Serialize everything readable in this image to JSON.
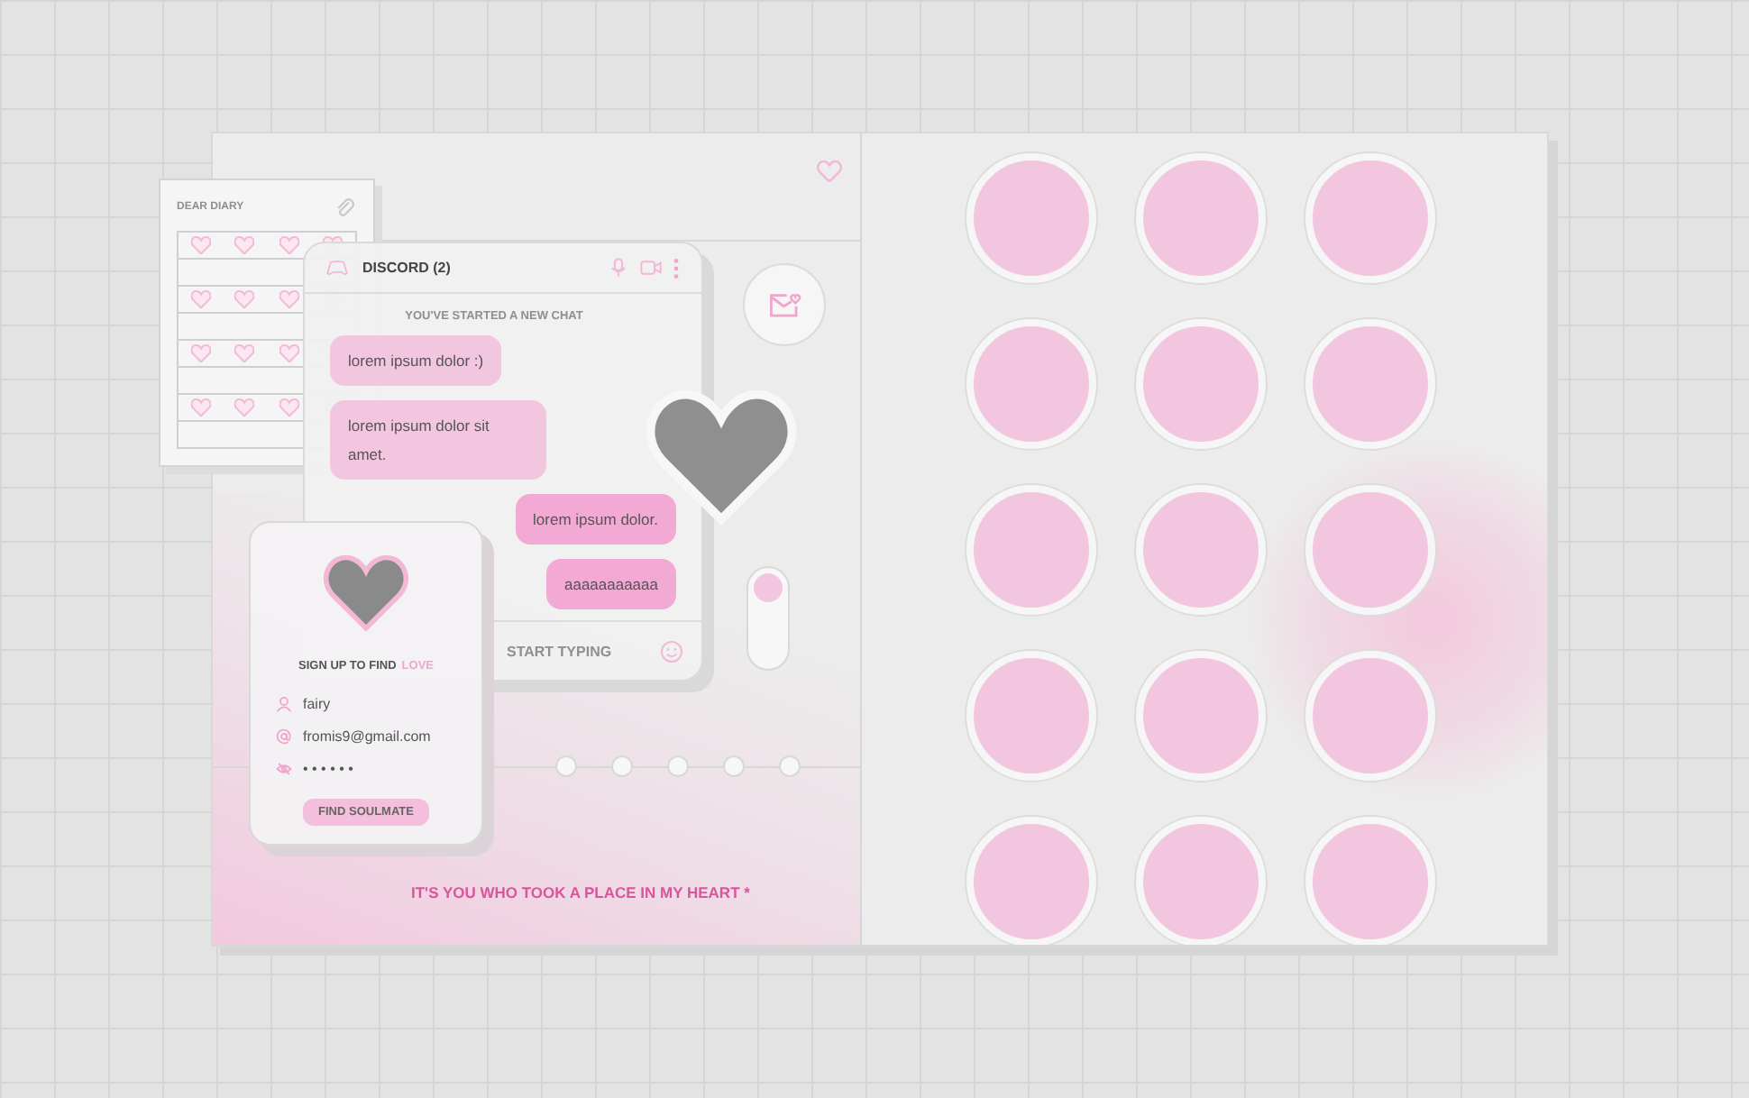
{
  "diary": {
    "title": "DEAR DIARY"
  },
  "chat": {
    "title": "DISCORD (2)",
    "notice": "YOU'VE STARTED A NEW CHAT",
    "input": {
      "placeholder": "START TYPING"
    },
    "messages": [
      {
        "text": "lorem ipsum dolor :)",
        "kind": "received"
      },
      {
        "text": "lorem ipsum dolor sit amet.",
        "kind": "received"
      },
      {
        "text": "lorem ipsum dolor.",
        "kind": "sent"
      },
      {
        "text": "aaaaaaaaaaa",
        "kind": "sent"
      }
    ]
  },
  "toggle": {
    "on": true
  },
  "signup": {
    "heading": "SIGN UP TO FIND",
    "highlight": "LOVE",
    "fields": [
      {
        "kind": "user",
        "value": "fairy"
      },
      {
        "kind": "email",
        "value": "fromis9@gmail.com"
      },
      {
        "kind": "password",
        "value": "• • • • • •"
      }
    ],
    "button": "FIND SOULMATE"
  },
  "tagline": "IT'S YOU WHO TOOK A PLACE IN MY HEART *"
}
